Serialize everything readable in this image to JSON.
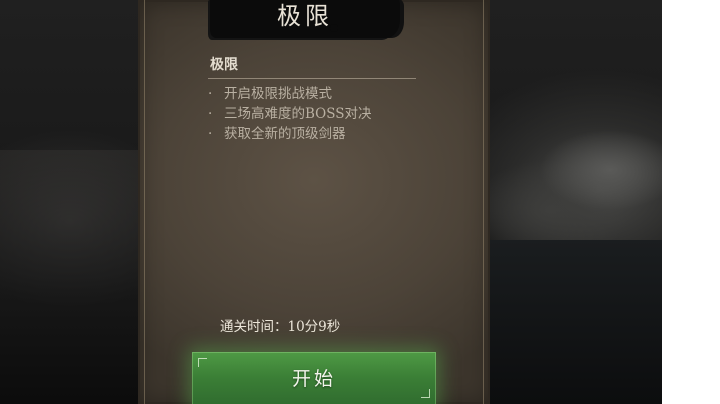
{
  "mode_panel": {
    "title": "极限",
    "section_title": "极限",
    "bullet_symbol": "·",
    "features": [
      "开启极限挑战模式",
      "三场高难度的BOSS对决",
      "获取全新的顶级剑器"
    ],
    "clear_time": "通关时间：10分9秒",
    "start_label": "开始"
  },
  "colors": {
    "panel": "#4c4338",
    "title_plate": "#0b0b0b",
    "start_button": "#3b7f36"
  }
}
